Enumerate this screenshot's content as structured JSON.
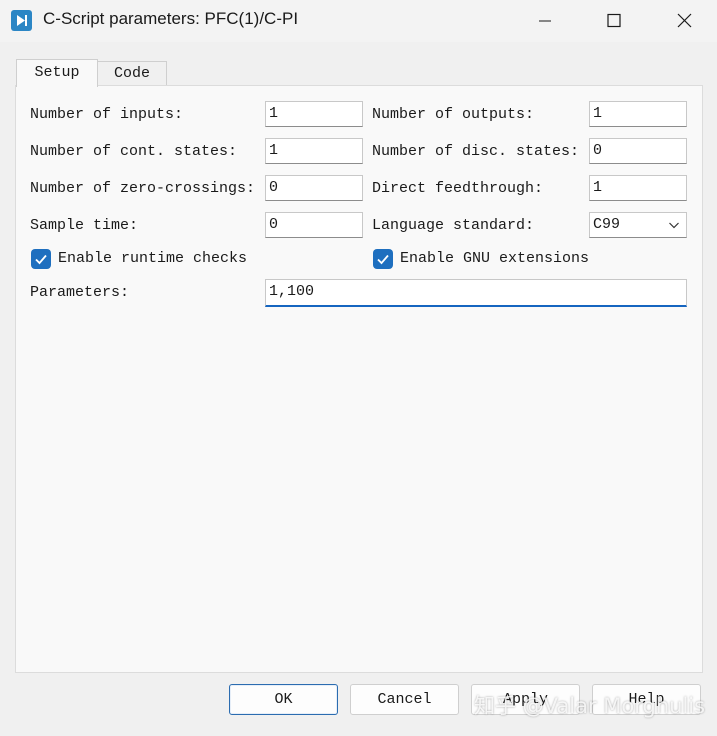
{
  "window": {
    "title": "C-Script parameters: PFC(1)/C-PI",
    "accent_color": "#1e6fbf",
    "icon": "plecs-app-icon"
  },
  "titlebar_buttons": [
    "minimize-icon",
    "maximize-icon",
    "close-icon"
  ],
  "tabs": [
    {
      "label": "Setup",
      "active": true
    },
    {
      "label": "Code",
      "active": false
    }
  ],
  "setup": {
    "num_inputs": {
      "label": "Number of inputs:",
      "value": "1"
    },
    "num_outputs": {
      "label": "Number of outputs:",
      "value": "1"
    },
    "num_cont_states": {
      "label": "Number of cont. states:",
      "value": "1"
    },
    "num_disc_states": {
      "label": "Number of disc. states:",
      "value": "0"
    },
    "num_zero_crossings": {
      "label": "Number of zero-crossings:",
      "value": "0"
    },
    "direct_feedthrough": {
      "label": "Direct feedthrough:",
      "value": "1"
    },
    "sample_time": {
      "label": "Sample time:",
      "value": "0"
    },
    "language_standard": {
      "label": "Language standard:",
      "value": "C99"
    },
    "runtime_checks": {
      "label": "Enable runtime checks",
      "checked": true
    },
    "gnu_extensions": {
      "label": "Enable GNU extensions",
      "checked": true
    },
    "parameters": {
      "label": "Parameters:",
      "value": "1,100"
    }
  },
  "buttons": {
    "ok": "OK",
    "cancel": "Cancel",
    "apply": "Apply",
    "help": "Help"
  },
  "watermark": "知乎 @Valar Morghulis"
}
